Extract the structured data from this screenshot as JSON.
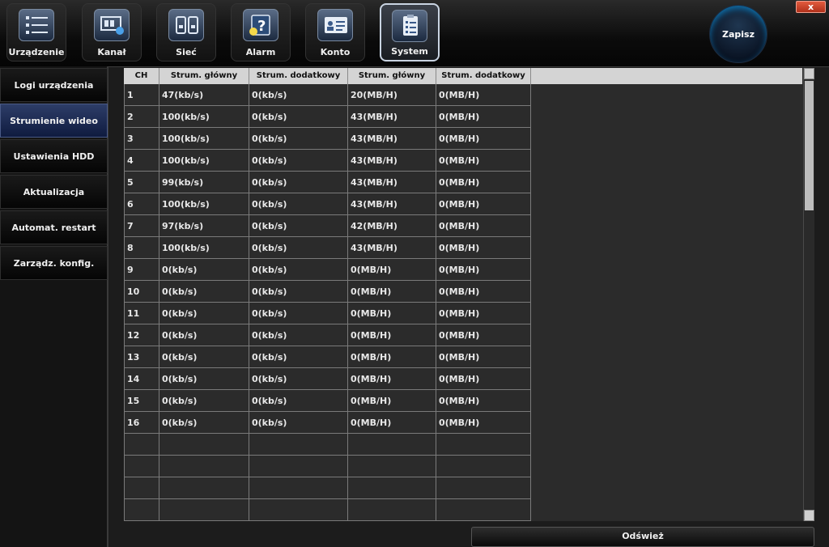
{
  "window": {
    "close_label": "x"
  },
  "tabs": [
    {
      "label": "Urządzenie",
      "icon": "device-list-icon"
    },
    {
      "label": "Kanał",
      "icon": "channel-camera-icon"
    },
    {
      "label": "Sieć",
      "icon": "network-icon"
    },
    {
      "label": "Alarm",
      "icon": "alarm-question-icon"
    },
    {
      "label": "Konto",
      "icon": "account-card-icon"
    },
    {
      "label": "System",
      "icon": "system-clipboard-icon",
      "active": true
    }
  ],
  "save_label": "Zapisz",
  "sidebar": {
    "items": [
      {
        "label": "Logi urządzenia"
      },
      {
        "label": "Strumienie wideo",
        "active": true
      },
      {
        "label": "Ustawienia HDD"
      },
      {
        "label": "Aktualizacja"
      },
      {
        "label": "Automat. restart"
      },
      {
        "label": "Zarządz. konfig."
      }
    ]
  },
  "table": {
    "headers": [
      "CH",
      "Strum. główny",
      "Strum. dodatkowy",
      "Strum. główny",
      "Strum. dodatkowy"
    ],
    "rows": [
      [
        "1",
        "47(kb/s)",
        "0(kb/s)",
        "20(MB/H)",
        "0(MB/H)"
      ],
      [
        "2",
        "100(kb/s)",
        "0(kb/s)",
        "43(MB/H)",
        "0(MB/H)"
      ],
      [
        "3",
        "100(kb/s)",
        "0(kb/s)",
        "43(MB/H)",
        "0(MB/H)"
      ],
      [
        "4",
        "100(kb/s)",
        "0(kb/s)",
        "43(MB/H)",
        "0(MB/H)"
      ],
      [
        "5",
        "99(kb/s)",
        "0(kb/s)",
        "43(MB/H)",
        "0(MB/H)"
      ],
      [
        "6",
        "100(kb/s)",
        "0(kb/s)",
        "43(MB/H)",
        "0(MB/H)"
      ],
      [
        "7",
        "97(kb/s)",
        "0(kb/s)",
        "42(MB/H)",
        "0(MB/H)"
      ],
      [
        "8",
        "100(kb/s)",
        "0(kb/s)",
        "43(MB/H)",
        "0(MB/H)"
      ],
      [
        "9",
        "0(kb/s)",
        "0(kb/s)",
        "0(MB/H)",
        "0(MB/H)"
      ],
      [
        "10",
        "0(kb/s)",
        "0(kb/s)",
        "0(MB/H)",
        "0(MB/H)"
      ],
      [
        "11",
        "0(kb/s)",
        "0(kb/s)",
        "0(MB/H)",
        "0(MB/H)"
      ],
      [
        "12",
        "0(kb/s)",
        "0(kb/s)",
        "0(MB/H)",
        "0(MB/H)"
      ],
      [
        "13",
        "0(kb/s)",
        "0(kb/s)",
        "0(MB/H)",
        "0(MB/H)"
      ],
      [
        "14",
        "0(kb/s)",
        "0(kb/s)",
        "0(MB/H)",
        "0(MB/H)"
      ],
      [
        "15",
        "0(kb/s)",
        "0(kb/s)",
        "0(MB/H)",
        "0(MB/H)"
      ],
      [
        "16",
        "0(kb/s)",
        "0(kb/s)",
        "0(MB/H)",
        "0(MB/H)"
      ],
      [
        "",
        "",
        "",
        "",
        ""
      ],
      [
        "",
        "",
        "",
        "",
        ""
      ],
      [
        "",
        "",
        "",
        "",
        ""
      ],
      [
        "",
        "",
        "",
        "",
        ""
      ]
    ]
  },
  "refresh_label": "Odśwież"
}
